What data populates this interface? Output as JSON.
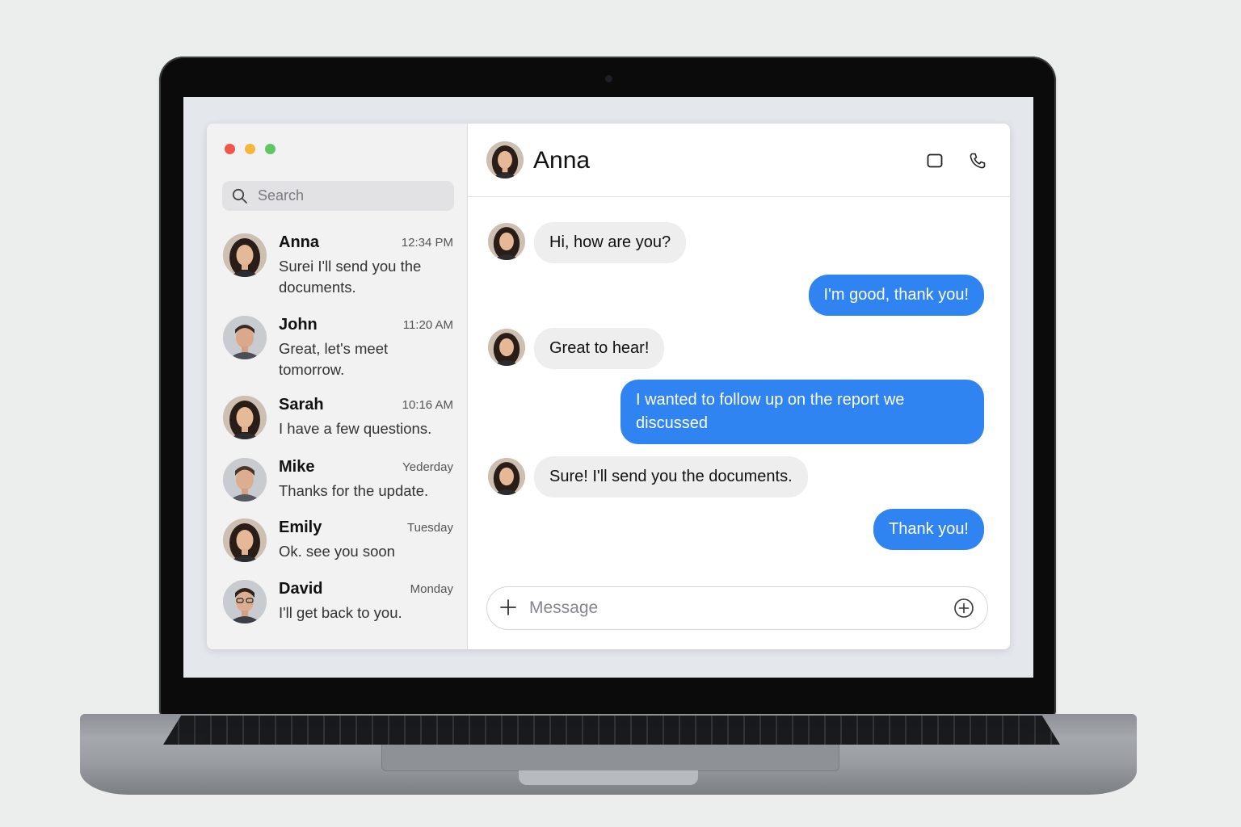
{
  "window": {
    "controls": [
      "close",
      "minimize",
      "zoom"
    ]
  },
  "sidebar": {
    "search": {
      "placeholder": "Search",
      "icon": "search-icon"
    },
    "conversations": [
      {
        "name": "Anna",
        "time": "12:34 PM",
        "preview": "Surei I'll send you the documents."
      },
      {
        "name": "John",
        "time": "11:20 AM",
        "preview": "Great, let's meet tomorrow."
      },
      {
        "name": "Sarah",
        "time": "10:16 AM",
        "preview": "I have a few questions."
      },
      {
        "name": "Mike",
        "time": "Yederday",
        "preview": "Thanks for the update."
      },
      {
        "name": "Emily",
        "time": "Tuesday",
        "preview": "Ok. see you soon"
      },
      {
        "name": "David",
        "time": "Monday",
        "preview": "I'll get back to you."
      }
    ]
  },
  "chat": {
    "title": "Anna",
    "header_icons": [
      "video-call-icon",
      "phone-icon"
    ],
    "messages": [
      {
        "from": "them",
        "text": "Hi, how are you?"
      },
      {
        "from": "me",
        "text": "I'm good, thank you!"
      },
      {
        "from": "them",
        "text": "Great to hear!"
      },
      {
        "from": "me",
        "text": "I wanted to follow up on the report we discussed"
      },
      {
        "from": "them",
        "text": "Sure! I'll send you the documents."
      },
      {
        "from": "me",
        "text": "Thank you!"
      }
    ],
    "composer": {
      "placeholder": "Message",
      "left_icon": "plus-icon",
      "right_icon": "add-circle-icon"
    }
  },
  "colors": {
    "accent": "#2f84f2",
    "incoming_bubble": "#eeeeef",
    "close": "#f2554a",
    "minimize": "#f6b53c",
    "zoom": "#5dc860"
  }
}
